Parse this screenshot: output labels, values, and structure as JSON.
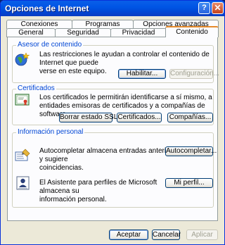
{
  "window": {
    "title": "Opciones de Internet"
  },
  "tabs_back": [
    "Conexiones",
    "Programas",
    "Opciones avanzadas"
  ],
  "tabs_front": [
    "General",
    "Seguridad",
    "Privacidad",
    "Contenido"
  ],
  "content_advisor": {
    "title": "Asesor de contenido",
    "text_line1": "Las restricciones le ayudan a controlar el contenido de Internet que puede",
    "text_line2": "verse en este equipo.",
    "enable_button": "Habilitar...",
    "settings_button": "Configuración..."
  },
  "certificates": {
    "title": "Certificados",
    "text_line1": "Los certificados le permitirán identificarse a sí mismo, a",
    "text_line2": "entidades emisoras de certificados y a compañías de software.",
    "clear_ssl_button": "Borrar estado SSL",
    "certificates_button": "Certificados...",
    "publishers_button": "Compañías..."
  },
  "personal_info": {
    "title": "Información personal",
    "autocomplete_line1": "Autocompletar almacena entradas anteriores y sugiere",
    "autocomplete_line2": "coincidencias.",
    "autocomplete_button": "Autocompletar...",
    "profile_line1": "El Asistente para perfiles de Microsoft almacena su",
    "profile_line2": "información personal.",
    "profile_button": "Mi perfil..."
  },
  "footer": {
    "ok": "Aceptar",
    "cancel": "Cancelar",
    "apply": "Aplicar"
  }
}
